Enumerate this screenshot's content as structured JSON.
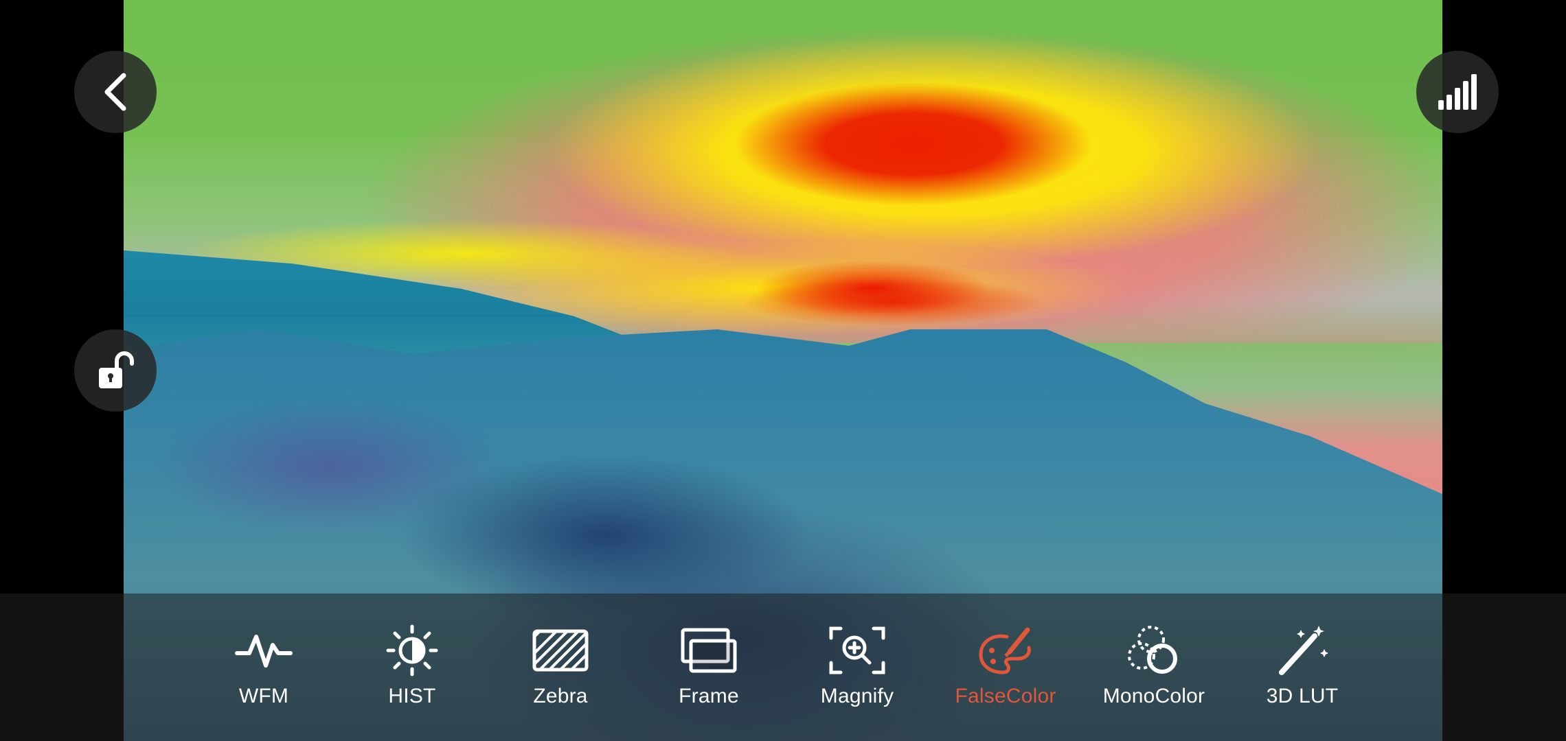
{
  "toolbar": {
    "items": [
      {
        "label": "WFM",
        "icon": "waveform-icon",
        "active": false
      },
      {
        "label": "HIST",
        "icon": "brightness-icon",
        "active": false
      },
      {
        "label": "Zebra",
        "icon": "zebra-stripes-icon",
        "active": false
      },
      {
        "label": "Frame",
        "icon": "frame-icon",
        "active": false
      },
      {
        "label": "Magnify",
        "icon": "magnify-icon",
        "active": false
      },
      {
        "label": "FalseColor",
        "icon": "palette-icon",
        "active": true
      },
      {
        "label": "MonoColor",
        "icon": "mono-color-icon",
        "active": false
      },
      {
        "label": "3D LUT",
        "icon": "magic-wand-icon",
        "active": false
      }
    ]
  },
  "buttons": {
    "back": "chevron-left-icon",
    "signal": "signal-bars-icon",
    "lock": "unlock-icon"
  },
  "colors": {
    "active_accent": "#e2563a",
    "inactive_label": "#ffffff"
  }
}
